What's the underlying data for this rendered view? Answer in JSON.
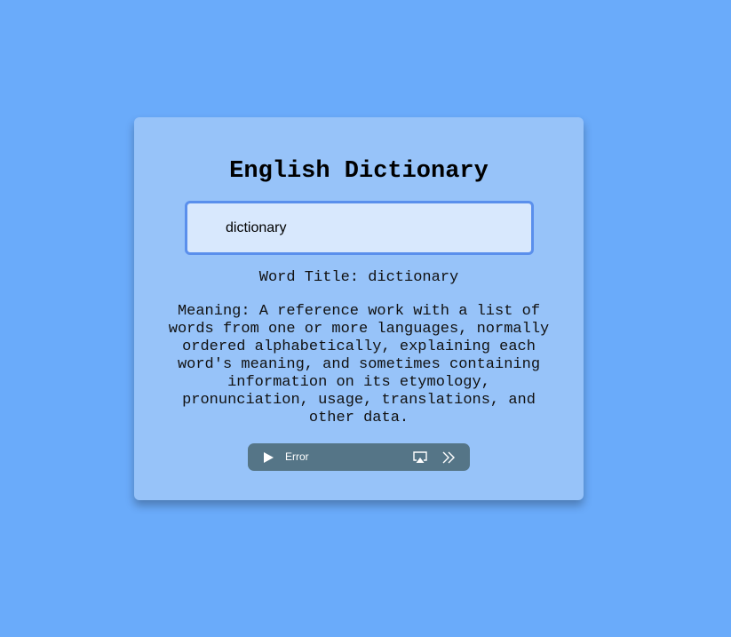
{
  "app": {
    "title": "English Dictionary"
  },
  "search": {
    "value": "dictionary"
  },
  "result": {
    "word_title": "Word Title: dictionary",
    "meaning": "Meaning: A reference work with a list of words from one or more languages, normally ordered alphabetically, explaining each word's meaning, and sometimes containing information on its etymology, pronunciation, usage, translations, and other data."
  },
  "audio": {
    "status": "Error",
    "icons": [
      "play-icon",
      "airplay-icon",
      "fast-forward-icon"
    ]
  },
  "colors": {
    "background": "#6aabfa",
    "card": "#97c3f9",
    "input_background": "#d8e8fd",
    "input_border": "#5a8fec",
    "player": "#557587"
  }
}
